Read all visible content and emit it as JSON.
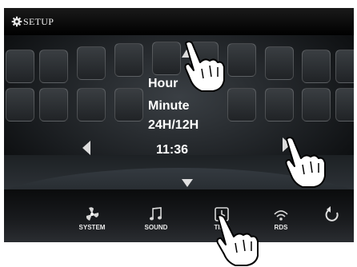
{
  "header": {
    "title": "SETUP",
    "icon": "gear-icon"
  },
  "menu": {
    "items": [
      "Hour",
      "Minute",
      "24H/12H"
    ],
    "value": "11:36"
  },
  "nav": {
    "items": [
      {
        "label": "SYSTEM",
        "icon": "fan-icon"
      },
      {
        "label": "SOUND",
        "icon": "music-note-icon"
      },
      {
        "label": "TIME",
        "icon": "clock-icon"
      },
      {
        "label": "RDS",
        "icon": "antenna-icon"
      }
    ],
    "back_icon": "back-arrow-icon"
  },
  "colors": {
    "background": "#000000",
    "text": "#ffffff"
  }
}
